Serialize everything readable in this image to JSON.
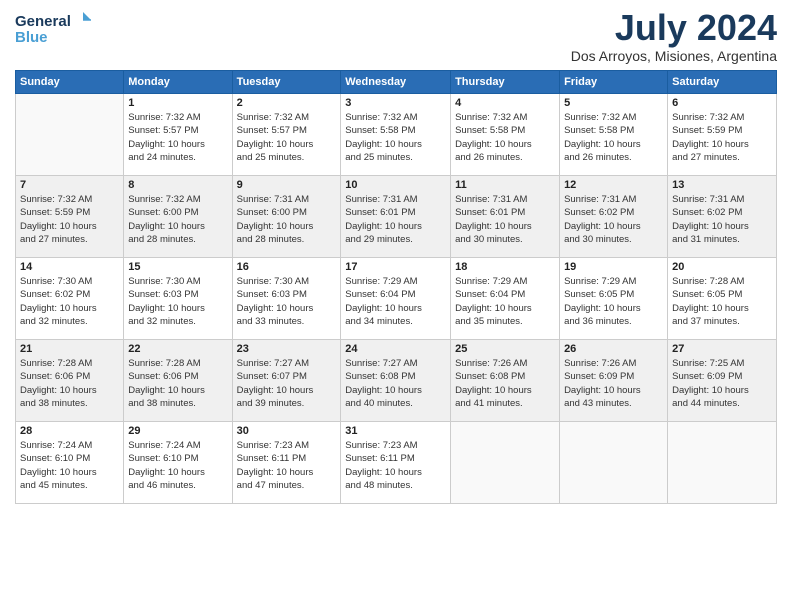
{
  "logo": {
    "line1": "General",
    "line2": "Blue"
  },
  "title": "July 2024",
  "location": "Dos Arroyos, Misiones, Argentina",
  "weekdays": [
    "Sunday",
    "Monday",
    "Tuesday",
    "Wednesday",
    "Thursday",
    "Friday",
    "Saturday"
  ],
  "weeks": [
    [
      {
        "day": "",
        "sunrise": "",
        "sunset": "",
        "daylight": ""
      },
      {
        "day": "1",
        "sunrise": "Sunrise: 7:32 AM",
        "sunset": "Sunset: 5:57 PM",
        "daylight": "Daylight: 10 hours and 24 minutes."
      },
      {
        "day": "2",
        "sunrise": "Sunrise: 7:32 AM",
        "sunset": "Sunset: 5:57 PM",
        "daylight": "Daylight: 10 hours and 25 minutes."
      },
      {
        "day": "3",
        "sunrise": "Sunrise: 7:32 AM",
        "sunset": "Sunset: 5:58 PM",
        "daylight": "Daylight: 10 hours and 25 minutes."
      },
      {
        "day": "4",
        "sunrise": "Sunrise: 7:32 AM",
        "sunset": "Sunset: 5:58 PM",
        "daylight": "Daylight: 10 hours and 26 minutes."
      },
      {
        "day": "5",
        "sunrise": "Sunrise: 7:32 AM",
        "sunset": "Sunset: 5:58 PM",
        "daylight": "Daylight: 10 hours and 26 minutes."
      },
      {
        "day": "6",
        "sunrise": "Sunrise: 7:32 AM",
        "sunset": "Sunset: 5:59 PM",
        "daylight": "Daylight: 10 hours and 27 minutes."
      }
    ],
    [
      {
        "day": "7",
        "sunrise": "Sunrise: 7:32 AM",
        "sunset": "Sunset: 5:59 PM",
        "daylight": "Daylight: 10 hours and 27 minutes."
      },
      {
        "day": "8",
        "sunrise": "Sunrise: 7:32 AM",
        "sunset": "Sunset: 6:00 PM",
        "daylight": "Daylight: 10 hours and 28 minutes."
      },
      {
        "day": "9",
        "sunrise": "Sunrise: 7:31 AM",
        "sunset": "Sunset: 6:00 PM",
        "daylight": "Daylight: 10 hours and 28 minutes."
      },
      {
        "day": "10",
        "sunrise": "Sunrise: 7:31 AM",
        "sunset": "Sunset: 6:01 PM",
        "daylight": "Daylight: 10 hours and 29 minutes."
      },
      {
        "day": "11",
        "sunrise": "Sunrise: 7:31 AM",
        "sunset": "Sunset: 6:01 PM",
        "daylight": "Daylight: 10 hours and 30 minutes."
      },
      {
        "day": "12",
        "sunrise": "Sunrise: 7:31 AM",
        "sunset": "Sunset: 6:02 PM",
        "daylight": "Daylight: 10 hours and 30 minutes."
      },
      {
        "day": "13",
        "sunrise": "Sunrise: 7:31 AM",
        "sunset": "Sunset: 6:02 PM",
        "daylight": "Daylight: 10 hours and 31 minutes."
      }
    ],
    [
      {
        "day": "14",
        "sunrise": "Sunrise: 7:30 AM",
        "sunset": "Sunset: 6:02 PM",
        "daylight": "Daylight: 10 hours and 32 minutes."
      },
      {
        "day": "15",
        "sunrise": "Sunrise: 7:30 AM",
        "sunset": "Sunset: 6:03 PM",
        "daylight": "Daylight: 10 hours and 32 minutes."
      },
      {
        "day": "16",
        "sunrise": "Sunrise: 7:30 AM",
        "sunset": "Sunset: 6:03 PM",
        "daylight": "Daylight: 10 hours and 33 minutes."
      },
      {
        "day": "17",
        "sunrise": "Sunrise: 7:29 AM",
        "sunset": "Sunset: 6:04 PM",
        "daylight": "Daylight: 10 hours and 34 minutes."
      },
      {
        "day": "18",
        "sunrise": "Sunrise: 7:29 AM",
        "sunset": "Sunset: 6:04 PM",
        "daylight": "Daylight: 10 hours and 35 minutes."
      },
      {
        "day": "19",
        "sunrise": "Sunrise: 7:29 AM",
        "sunset": "Sunset: 6:05 PM",
        "daylight": "Daylight: 10 hours and 36 minutes."
      },
      {
        "day": "20",
        "sunrise": "Sunrise: 7:28 AM",
        "sunset": "Sunset: 6:05 PM",
        "daylight": "Daylight: 10 hours and 37 minutes."
      }
    ],
    [
      {
        "day": "21",
        "sunrise": "Sunrise: 7:28 AM",
        "sunset": "Sunset: 6:06 PM",
        "daylight": "Daylight: 10 hours and 38 minutes."
      },
      {
        "day": "22",
        "sunrise": "Sunrise: 7:28 AM",
        "sunset": "Sunset: 6:06 PM",
        "daylight": "Daylight: 10 hours and 38 minutes."
      },
      {
        "day": "23",
        "sunrise": "Sunrise: 7:27 AM",
        "sunset": "Sunset: 6:07 PM",
        "daylight": "Daylight: 10 hours and 39 minutes."
      },
      {
        "day": "24",
        "sunrise": "Sunrise: 7:27 AM",
        "sunset": "Sunset: 6:08 PM",
        "daylight": "Daylight: 10 hours and 40 minutes."
      },
      {
        "day": "25",
        "sunrise": "Sunrise: 7:26 AM",
        "sunset": "Sunset: 6:08 PM",
        "daylight": "Daylight: 10 hours and 41 minutes."
      },
      {
        "day": "26",
        "sunrise": "Sunrise: 7:26 AM",
        "sunset": "Sunset: 6:09 PM",
        "daylight": "Daylight: 10 hours and 43 minutes."
      },
      {
        "day": "27",
        "sunrise": "Sunrise: 7:25 AM",
        "sunset": "Sunset: 6:09 PM",
        "daylight": "Daylight: 10 hours and 44 minutes."
      }
    ],
    [
      {
        "day": "28",
        "sunrise": "Sunrise: 7:24 AM",
        "sunset": "Sunset: 6:10 PM",
        "daylight": "Daylight: 10 hours and 45 minutes."
      },
      {
        "day": "29",
        "sunrise": "Sunrise: 7:24 AM",
        "sunset": "Sunset: 6:10 PM",
        "daylight": "Daylight: 10 hours and 46 minutes."
      },
      {
        "day": "30",
        "sunrise": "Sunrise: 7:23 AM",
        "sunset": "Sunset: 6:11 PM",
        "daylight": "Daylight: 10 hours and 47 minutes."
      },
      {
        "day": "31",
        "sunrise": "Sunrise: 7:23 AM",
        "sunset": "Sunset: 6:11 PM",
        "daylight": "Daylight: 10 hours and 48 minutes."
      },
      {
        "day": "",
        "sunrise": "",
        "sunset": "",
        "daylight": ""
      },
      {
        "day": "",
        "sunrise": "",
        "sunset": "",
        "daylight": ""
      },
      {
        "day": "",
        "sunrise": "",
        "sunset": "",
        "daylight": ""
      }
    ]
  ]
}
